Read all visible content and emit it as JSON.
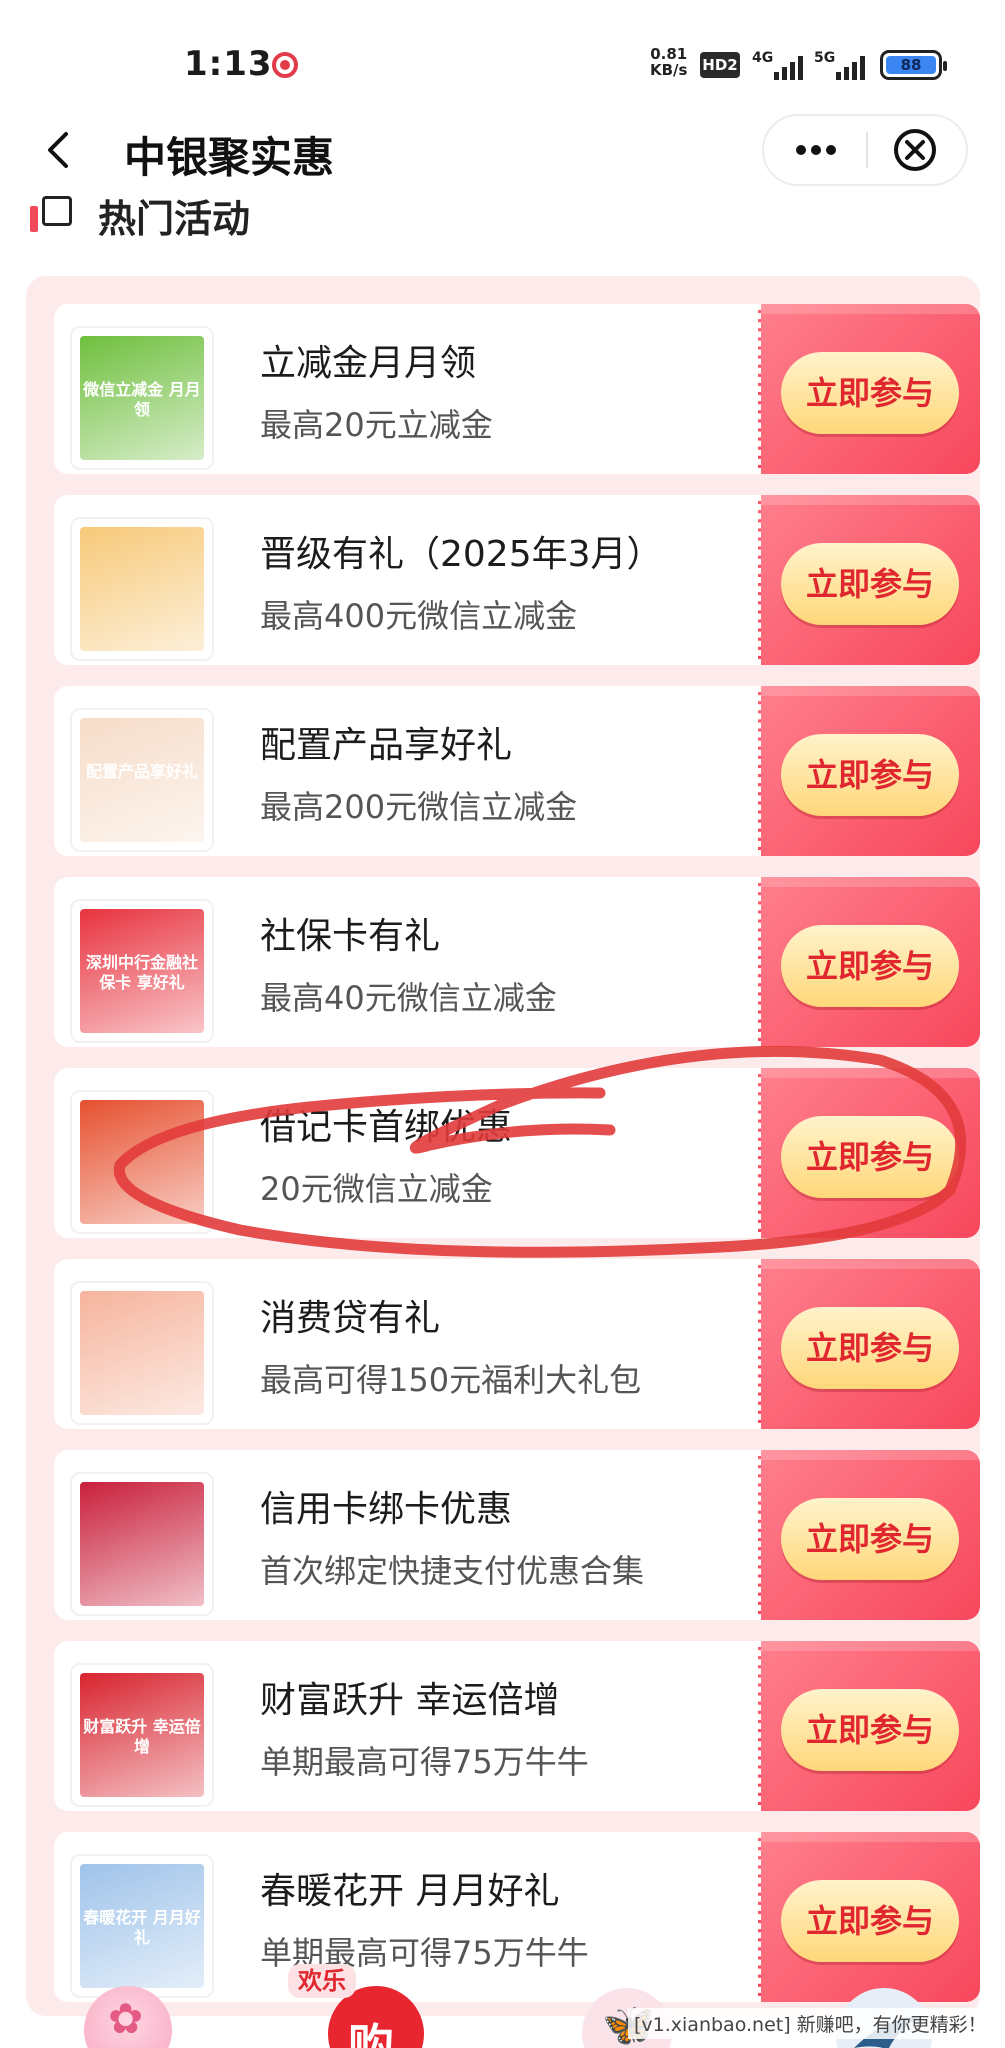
{
  "status_bar": {
    "time": "1:13",
    "net_speed_value": "0.81",
    "net_speed_unit": "KB/s",
    "hd_badge": "HD2",
    "signal_1_label": "4G",
    "signal_2_label": "5G",
    "battery_level": "88"
  },
  "nav": {
    "title": "中银聚实惠"
  },
  "section": {
    "heading": "热门活动"
  },
  "join_label": "立即参与",
  "activities": [
    {
      "title": "立减金月月领",
      "subtitle": "最高20元立减金",
      "thumb_text": "微信立减金 月月领",
      "thumb_color": "#6fbf3e"
    },
    {
      "title": "晋级有礼（2025年3月）",
      "subtitle": "最高400元微信立减金",
      "thumb_text": "",
      "thumb_color": "#f7c979"
    },
    {
      "title": "配置产品享好礼",
      "subtitle": "最高200元微信立减金",
      "thumb_text": "配置产品享好礼",
      "thumb_color": "#f6dcc8"
    },
    {
      "title": "社保卡有礼",
      "subtitle": "最高40元微信立减金",
      "thumb_text": "深圳中行金融社保卡 享好礼",
      "thumb_color": "#e8333f"
    },
    {
      "title": "借记卡首绑优惠",
      "subtitle": "20元微信立减金",
      "thumb_text": "",
      "thumb_color": "#e6502f"
    },
    {
      "title": "消费贷有礼",
      "subtitle": "最高可得150元福利大礼包",
      "thumb_text": "",
      "thumb_color": "#f6b49c"
    },
    {
      "title": "信用卡绑卡优惠",
      "subtitle": "首次绑定快捷支付优惠合集",
      "thumb_text": "",
      "thumb_color": "#c91f3b"
    },
    {
      "title": "财富跃升 幸运倍增",
      "subtitle": "单期最高可得75万牛牛",
      "thumb_text": "财富跃升 幸运倍增",
      "thumb_color": "#d8242f"
    },
    {
      "title": "春暖花开 月月好礼",
      "subtitle": "单期最高可得75万牛牛",
      "thumb_text": "春暖花开 月月好礼",
      "thumb_color": "#9fc3ea"
    }
  ],
  "tabbar": {
    "badge": "欢乐",
    "center_glyph": "购"
  },
  "watermark": "[v1.xianbao.net] 新赚吧，有你更精彩！",
  "colors": {
    "accent": "#f7475c",
    "button_bg": "#ffd77a",
    "button_text": "#e0262f",
    "panel_bg": "#fdebec",
    "annotation": "#e23b3b"
  }
}
